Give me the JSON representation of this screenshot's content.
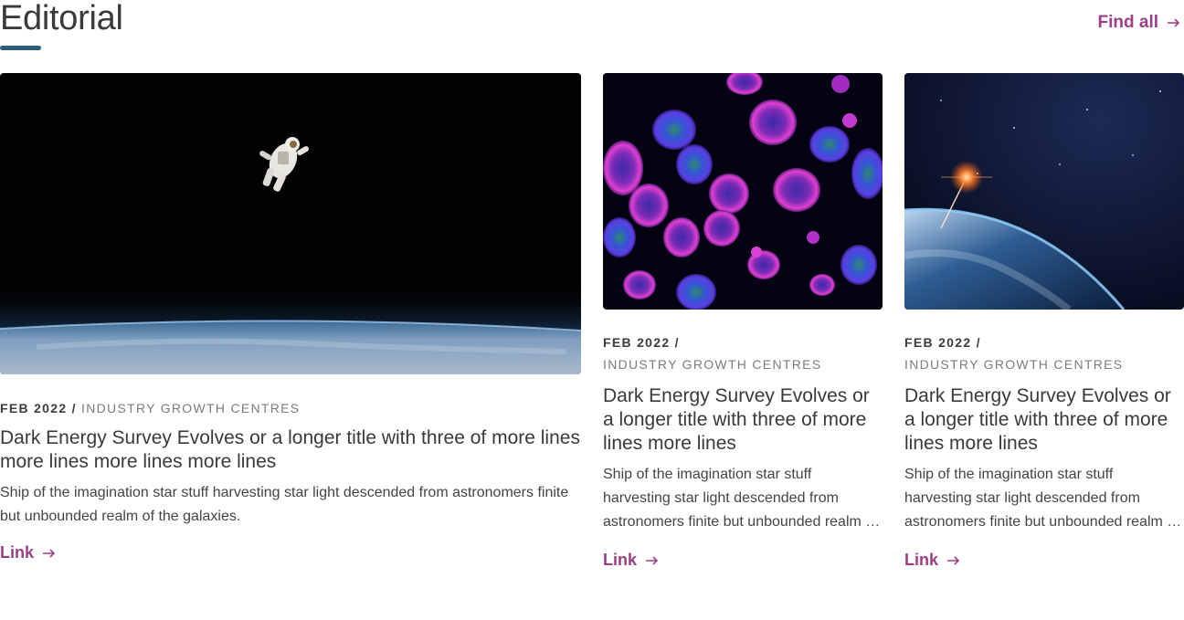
{
  "section": {
    "title": "Editorial",
    "find_all_label": "Find all",
    "accent_color": "#2e5d7a",
    "link_color": "#9b3f86"
  },
  "cards": [
    {
      "image": "astronaut-over-earth",
      "date": "FEB 2022",
      "separator": "/",
      "category": "INDUSTRY GROWTH CENTRES",
      "title": "Dark Energy Survey Evolves or a longer title with three of more lines more lines more lines more lines",
      "description": "Ship of the imagination star stuff harvesting star light descended from astronomers finite but unbounded realm of the galaxies.",
      "link_label": "Link"
    },
    {
      "image": "fluorescent-cells",
      "date": "FEB 2022",
      "separator": "/",
      "category": "INDUSTRY GROWTH CENTRES",
      "title": "Dark Energy Survey Evolves or a longer title with three of more lines more lines",
      "description": "Ship of the imagination star stuff harvesting star light descended from astronomers finite but unbounded realm of the galaxies.",
      "link_label": "Link"
    },
    {
      "image": "earth-horizon-flare",
      "date": "FEB 2022",
      "separator": "/",
      "category": "INDUSTRY GROWTH CENTRES",
      "title": "Dark Energy Survey Evolves or a longer title with three of more lines more lines",
      "description": "Ship of the imagination star stuff harvesting star light descended from astronomers finite but unbounded realm of the galaxies.",
      "link_label": "Link"
    }
  ]
}
